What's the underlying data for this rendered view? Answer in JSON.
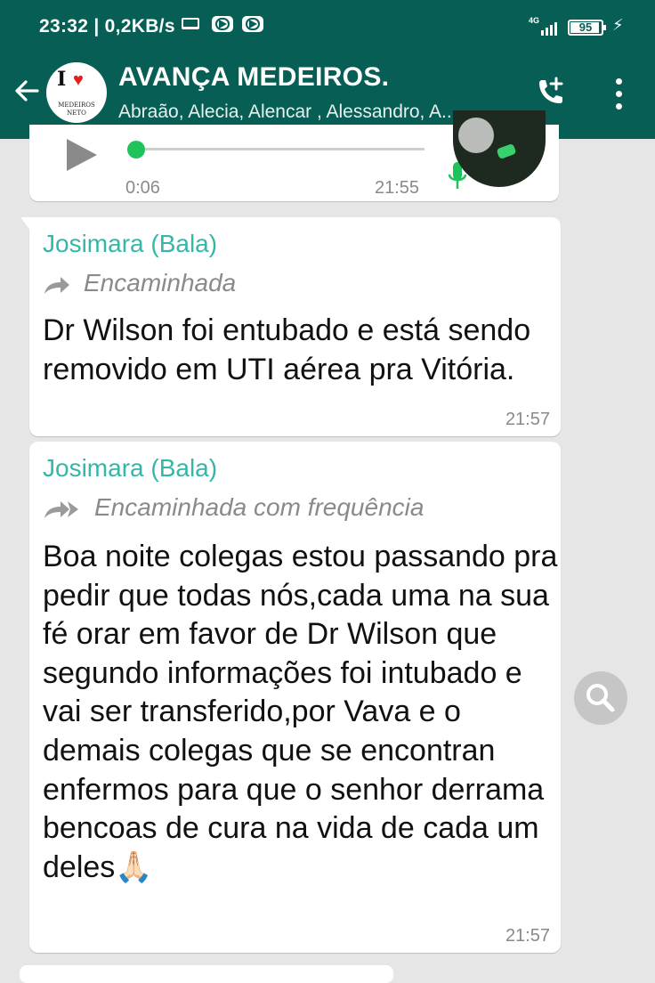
{
  "status_bar": {
    "time_speed": "23:32 | 0,2KB/s",
    "network": "4G",
    "battery_percent": "95",
    "battery_level": 0.95,
    "icons": [
      "laptop-icon",
      "youtube-icon",
      "youtube-icon",
      "signal-icon",
      "battery-icon",
      "charging-bolt-icon"
    ]
  },
  "header": {
    "title": "AVANÇA MEDEIROS.",
    "participants": "Abraão, Alecia, Alencar , Alessandro, A...",
    "avatar_text_1": "MEDEIROS",
    "avatar_text_2": "NETO",
    "accent": "#075e54"
  },
  "voice_message": {
    "duration": "0:06",
    "time": "21:55",
    "progress": 0.0
  },
  "messages": [
    {
      "sender": "Josimara (Bala)",
      "forward_label": "Encaminhada",
      "text": "Dr Wilson foi entubado e está sendo removido em UTI aérea pra Vitória.",
      "time": "21:57"
    },
    {
      "sender": "Josimara (Bala)",
      "forward_label": "Encaminhada com frequência",
      "text": "Boa noite colegas estou passando pra pedir que todas nós,cada uma na sua fé orar em favor de Dr Wilson que segundo informações foi intubado e vai ser transferido,por Vava e o demais colegas que se encontran enfermos para que o senhor derrama bencoas de cura na vida de cada um deles🙏🏻",
      "time": "21:57"
    }
  ],
  "colors": {
    "sender": "#34b7a7",
    "chat_bg": "#e6e6e6",
    "bubble": "#ffffff",
    "timestamp": "#8a8a8a"
  }
}
